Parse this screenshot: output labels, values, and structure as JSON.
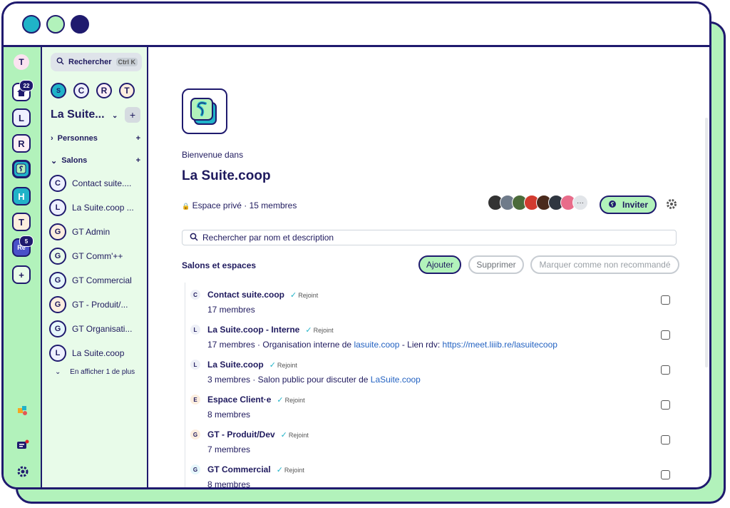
{
  "window": {
    "controls": [
      "close",
      "minimize",
      "maximize"
    ]
  },
  "rail": {
    "user_initial": "T",
    "items": [
      {
        "label": "home",
        "badge": "22"
      },
      {
        "label": "L"
      },
      {
        "label": "R"
      },
      {
        "label": "S"
      },
      {
        "label": "H"
      },
      {
        "label": "T"
      },
      {
        "label": "Re",
        "badge": "5"
      },
      {
        "label": "+"
      }
    ]
  },
  "roomlist": {
    "search_label": "Rechercher",
    "search_shortcut": "Ctrl K",
    "recents": [
      "S",
      "C",
      "R",
      "T"
    ],
    "space_title": "La Suite...",
    "sections": {
      "people": "Personnes",
      "rooms": "Salons"
    },
    "rooms": [
      {
        "initial": "C",
        "name": "Contact suite...."
      },
      {
        "initial": "L",
        "name": "La Suite.coop ..."
      },
      {
        "initial": "G",
        "name": "GT Admin"
      },
      {
        "initial": "G",
        "name": "GT Comm'++"
      },
      {
        "initial": "G",
        "name": "GT Commercial"
      },
      {
        "initial": "G",
        "name": "GT - Produit/..."
      },
      {
        "initial": "G",
        "name": "GT Organisati..."
      },
      {
        "initial": "L",
        "name": "La Suite.coop"
      }
    ],
    "show_more": "En afficher 1 de plus"
  },
  "main": {
    "welcome": "Bienvenue dans",
    "title": "La Suite.coop",
    "visibility": "Espace privé",
    "member_count": "15 membres",
    "invite_label": "Inviter",
    "search_placeholder": "Rechercher par nom et description",
    "list_title": "Salons et espaces",
    "btn_add": "Ajouter",
    "btn_remove": "Supprimer",
    "btn_mark": "Marquer comme non recommandé",
    "joined_label": "Rejoint",
    "rooms": [
      {
        "initial": "C",
        "name": "Contact suite.coop",
        "desc_a": "17 membres",
        "link1": "",
        "desc_b": "",
        "link2": ""
      },
      {
        "initial": "L",
        "name": "La Suite.coop - Interne",
        "desc_a": "17 membres · Organisation interne de ",
        "link1": "lasuite.coop",
        "desc_b": " - Lien rdv: ",
        "link2": "https://meet.liiib.re/lasuitecoop"
      },
      {
        "initial": "L",
        "name": "La Suite.coop",
        "desc_a": "3 membres · Salon public pour discuter de ",
        "link1": "LaSuite.coop",
        "desc_b": "",
        "link2": ""
      },
      {
        "initial": "E",
        "name": "Espace Client·e",
        "desc_a": "8 membres",
        "link1": "",
        "desc_b": "",
        "link2": ""
      },
      {
        "initial": "G",
        "name": "GT - Produit/Dev",
        "desc_a": "7 membres",
        "link1": "",
        "desc_b": "",
        "link2": ""
      },
      {
        "initial": "G",
        "name": "GT Commercial",
        "desc_a": "8 membres",
        "link1": "",
        "desc_b": "",
        "link2": ""
      }
    ]
  },
  "colors": {
    "accent_green": "#b2f2bb",
    "navy": "#1f1a6e",
    "teal": "#20b3c8",
    "link": "#2463c2"
  }
}
